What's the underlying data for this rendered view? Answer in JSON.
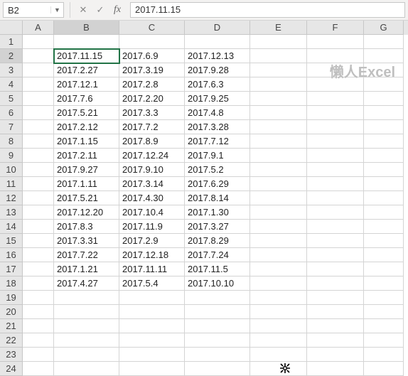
{
  "formula_bar": {
    "name_box": "B2",
    "cancel": "✕",
    "confirm": "✓",
    "fx": "fx",
    "formula": "2017.11.15"
  },
  "columns": [
    "A",
    "B",
    "C",
    "D",
    "E",
    "F",
    "G"
  ],
  "active_cell": "B2",
  "watermark": "懒人Excel",
  "chart_data": {
    "type": "table",
    "title": "",
    "columns": [
      "B",
      "C",
      "D"
    ],
    "rows": [
      [
        "2017.11.15",
        "2017.6.9",
        "2017.12.13"
      ],
      [
        "2017.2.27",
        "2017.3.19",
        "2017.9.28"
      ],
      [
        "2017.12.1",
        "2017.2.8",
        "2017.6.3"
      ],
      [
        "2017.7.6",
        "2017.2.20",
        "2017.9.25"
      ],
      [
        "2017.5.21",
        "2017.3.3",
        "2017.4.8"
      ],
      [
        "2017.2.12",
        "2017.7.2",
        "2017.3.28"
      ],
      [
        "2017.1.15",
        "2017.8.9",
        "2017.7.12"
      ],
      [
        "2017.2.11",
        "2017.12.24",
        "2017.9.1"
      ],
      [
        "2017.9.27",
        "2017.9.10",
        "2017.5.2"
      ],
      [
        "2017.1.11",
        "2017.3.14",
        "2017.6.29"
      ],
      [
        "2017.5.21",
        "2017.4.30",
        "2017.8.14"
      ],
      [
        "2017.12.20",
        "2017.10.4",
        "2017.1.30"
      ],
      [
        "2017.8.3",
        "2017.11.9",
        "2017.3.27"
      ],
      [
        "2017.3.31",
        "2017.2.9",
        "2017.8.29"
      ],
      [
        "2017.7.22",
        "2017.12.18",
        "2017.7.24"
      ],
      [
        "2017.1.21",
        "2017.11.11",
        "2017.11.5"
      ],
      [
        "2017.4.27",
        "2017.5.4",
        "2017.10.10"
      ]
    ]
  },
  "row_count": 24
}
